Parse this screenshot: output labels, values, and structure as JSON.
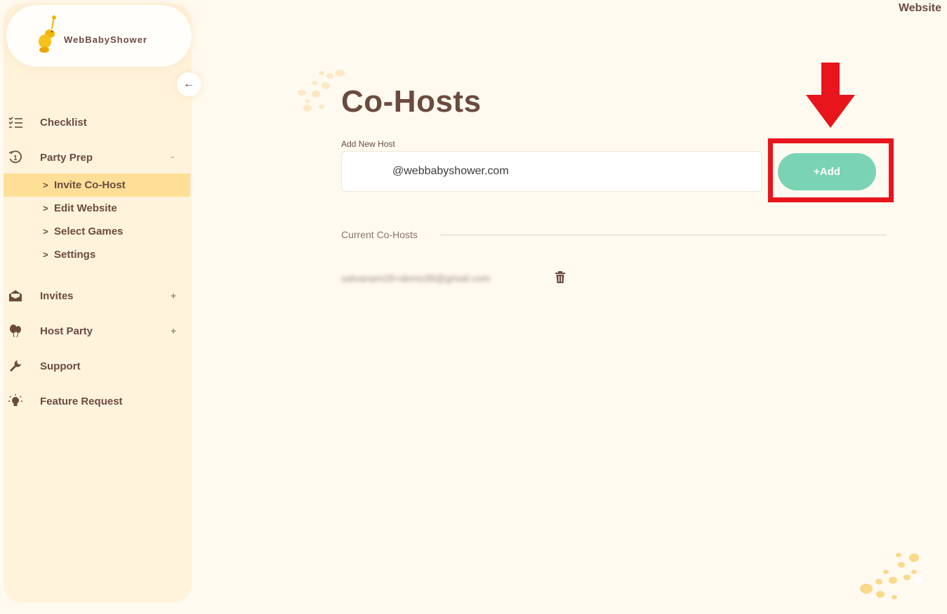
{
  "brand": {
    "name": "WebBabyShower"
  },
  "header": {
    "right_link": "Website"
  },
  "sidebar": {
    "collapse_icon": "arrow-left-icon",
    "items": [
      {
        "label": "Checklist",
        "icon": "checklist-icon",
        "toggle": ""
      },
      {
        "label": "Party Prep",
        "icon": "clock-one-icon",
        "toggle": "−"
      },
      {
        "label": "Invites",
        "icon": "envelope-open-icon",
        "toggle": "+"
      },
      {
        "label": "Host Party",
        "icon": "balloons-icon",
        "toggle": "+"
      },
      {
        "label": "Support",
        "icon": "wrench-icon",
        "toggle": ""
      },
      {
        "label": "Feature Request",
        "icon": "lightbulb-icon",
        "toggle": ""
      }
    ],
    "sub_items": [
      {
        "label": "Invite Co-Host",
        "active": true
      },
      {
        "label": "Edit Website",
        "active": false
      },
      {
        "label": "Select Games",
        "active": false
      },
      {
        "label": "Settings",
        "active": false
      }
    ],
    "chevron": ">"
  },
  "main": {
    "title": "Co-Hosts",
    "add_host": {
      "label": "Add New Host",
      "value": "@webbabyshower.com",
      "button_label": "+Add"
    },
    "current": {
      "label": "Current Co-Hosts",
      "hosts": [
        {
          "email": "salvanam28+demo38@gmail.com"
        }
      ]
    }
  },
  "colors": {
    "accent": "#7bd3b6",
    "highlight": "#e8151c",
    "active_item": "#ffdf98",
    "text": "#6b4b3e"
  }
}
